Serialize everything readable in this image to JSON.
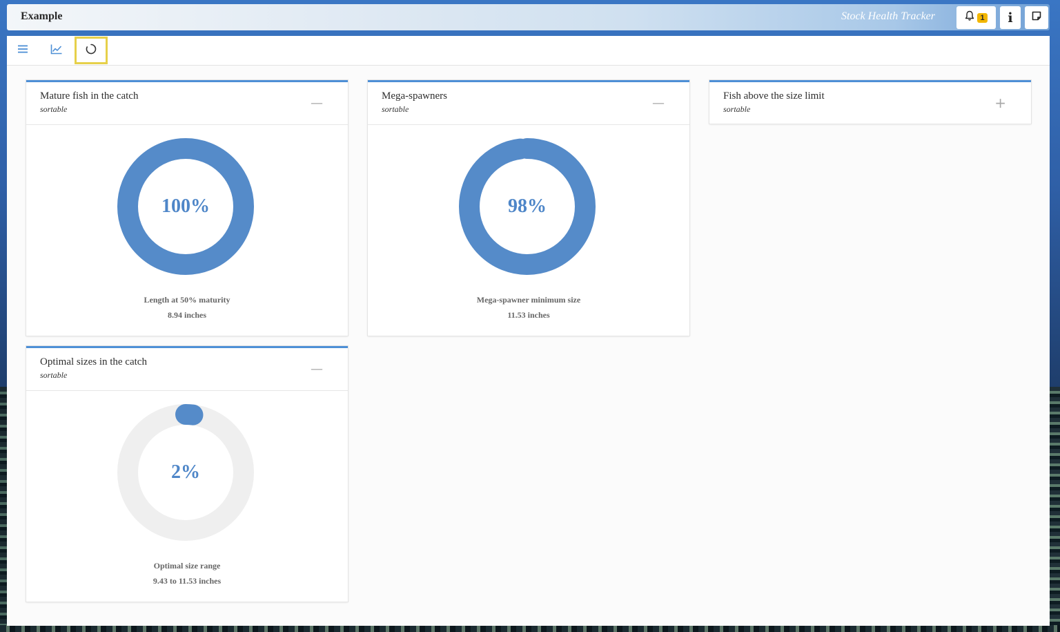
{
  "header": {
    "title": "Example",
    "subtitle": "Stock Health Tracker",
    "notifications_count": "1",
    "info_label": "i"
  },
  "toolbar": {
    "icons": [
      "menu-icon",
      "line-chart-icon",
      "refresh-circle-icon"
    ]
  },
  "colors": {
    "accent": "#4d8fd6",
    "donut_fill": "#558bc9",
    "donut_track": "#efefef",
    "highlight": "#e6d04a",
    "badge": "#f2b600"
  },
  "cards": [
    {
      "title": "Mature fish in the catch",
      "subtitle": "sortable",
      "toggle": "—",
      "collapsed": false,
      "percent_label": "100%",
      "percent_value": 100,
      "stat_name": "Length at 50% maturity",
      "stat_value": "8.94 inches"
    },
    {
      "title": "Mega-spawners",
      "subtitle": "sortable",
      "toggle": "—",
      "collapsed": false,
      "percent_label": "98%",
      "percent_value": 98,
      "stat_name": "Mega-spawner minimum size",
      "stat_value": "11.53 inches"
    },
    {
      "title": "Fish above the size limit",
      "subtitle": "sortable",
      "toggle": "+",
      "collapsed": true
    },
    {
      "title": "Optimal sizes in the catch",
      "subtitle": "sortable",
      "toggle": "—",
      "collapsed": false,
      "percent_label": "2%",
      "percent_value": 2,
      "stat_name": "Optimal size range",
      "stat_value": "9.43 to 11.53 inches"
    }
  ]
}
